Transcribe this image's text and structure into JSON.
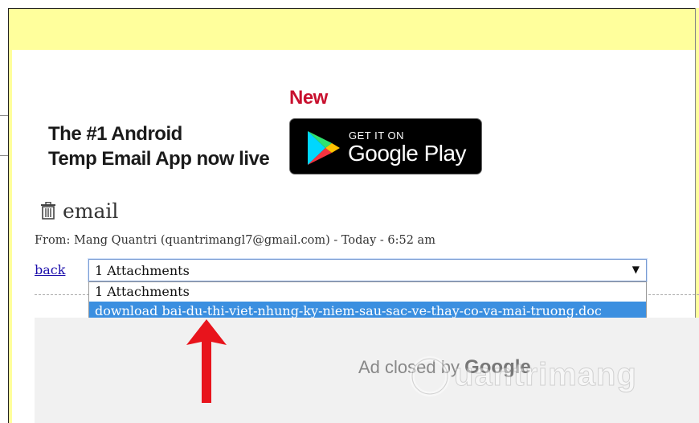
{
  "promo": {
    "line1": "The #1 Android",
    "line2": "Temp Email App now live",
    "new_label": "New",
    "store_small": "GET IT ON",
    "store_big": "Google Play"
  },
  "email": {
    "heading": "email",
    "from_line": "From: Mang Quantri (quantrimangl7@gmail.com) - Today - 6:52 am",
    "back_label": "back",
    "attachments_select": {
      "selected": "1 Attachments",
      "options": [
        "1 Attachments",
        "download bai-du-thi-viet-nhung-ky-niem-sau-sac-ve-thay-co-va-mai-truong.doc"
      ]
    }
  },
  "ad": {
    "closed_prefix": "Ad closed by",
    "closed_brand": "Google"
  },
  "watermark": {
    "text": "uantrimang"
  },
  "colors": {
    "header_yellow": "#ffff9c",
    "new_red": "#c8102e",
    "link_blue": "#1a0dab",
    "option_highlight": "#3b8fe0",
    "arrow_red": "#e8141c"
  }
}
